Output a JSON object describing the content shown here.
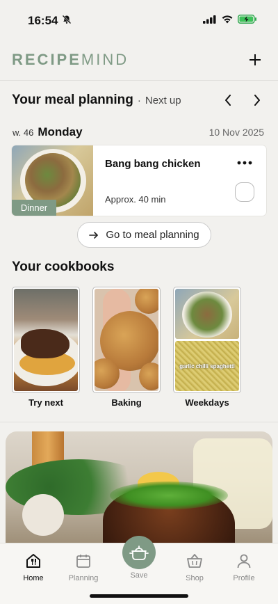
{
  "status_bar": {
    "time": "16:54",
    "icons": [
      "bell-slash-icon",
      "signal-icon",
      "wifi-icon",
      "battery-charging-icon"
    ]
  },
  "header": {
    "logo_bold": "RECIPE",
    "logo_light": "MIND",
    "add_icon": "plus-icon",
    "brand_color": "#7f9a85"
  },
  "meal_planning": {
    "title": "Your meal planning",
    "separator": "·",
    "subtitle": "Next up",
    "week": "w. 46",
    "day": "Monday",
    "date": "10 Nov 2025",
    "meal": {
      "tag": "Dinner",
      "name": "Bang bang chicken",
      "time": "Approx. 40 min",
      "more_icon": "more-horizontal-icon"
    },
    "goto_label": "Go to meal planning"
  },
  "cookbooks": {
    "title": "Your cookbooks",
    "items": [
      {
        "label": "Try next"
      },
      {
        "label": "Baking"
      },
      {
        "label": "Weekdays",
        "caption": "garlic chilli spaghetti"
      }
    ]
  },
  "tabbar": {
    "tabs": [
      {
        "label": "Home",
        "icon": "home-icon",
        "active": true
      },
      {
        "label": "Planning",
        "icon": "calendar-icon"
      },
      {
        "label": "Save",
        "icon": "pot-icon"
      },
      {
        "label": "Shop",
        "icon": "basket-icon"
      },
      {
        "label": "Profile",
        "icon": "person-icon"
      }
    ]
  }
}
